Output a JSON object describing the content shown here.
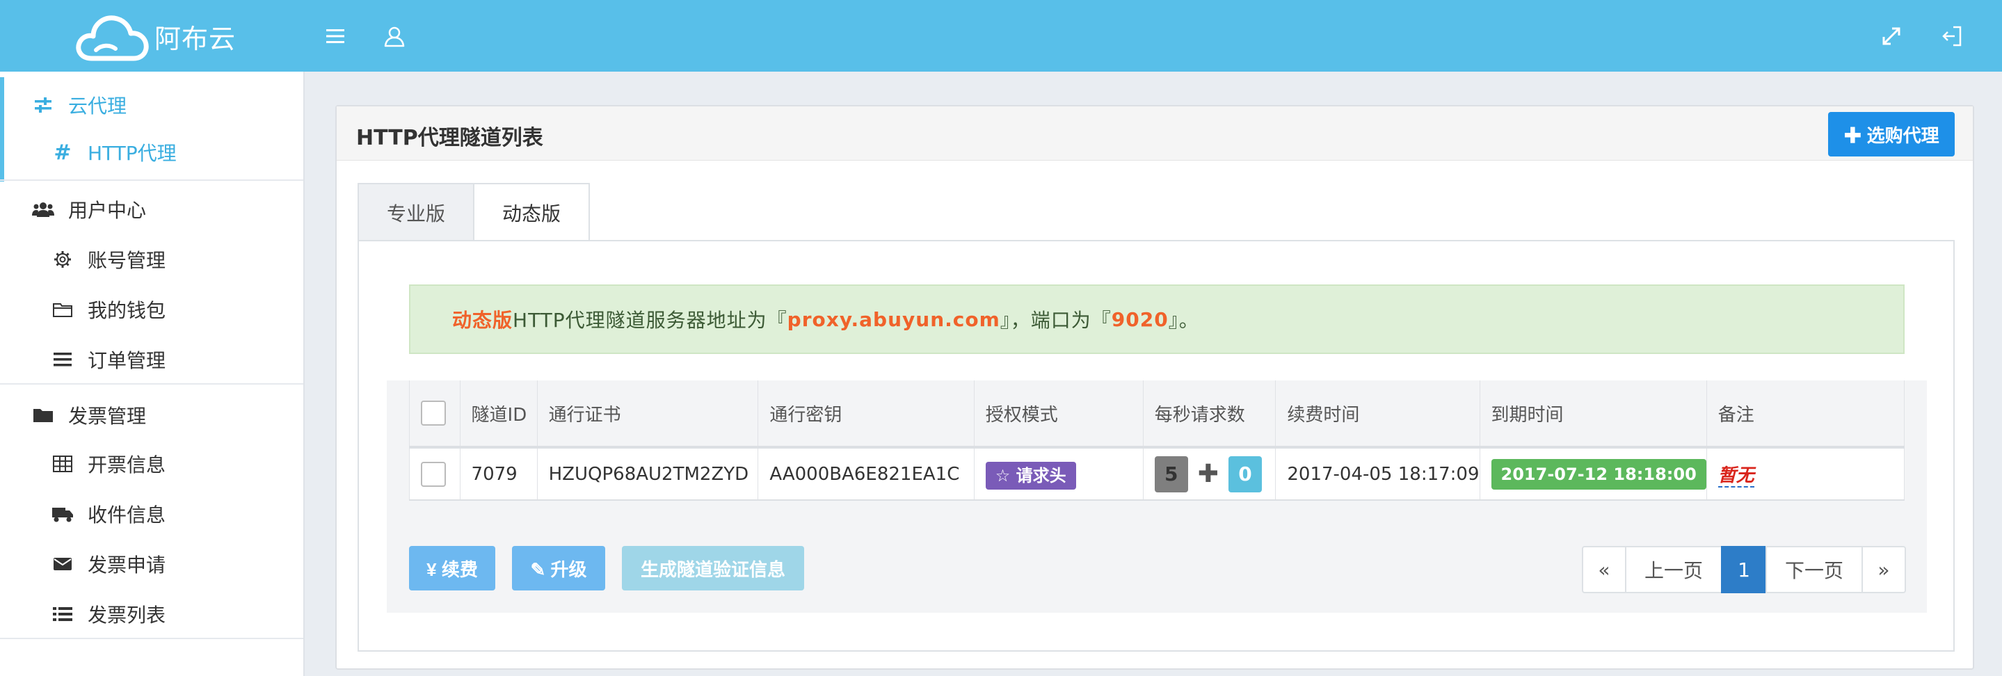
{
  "app": {
    "brand": "阿布云"
  },
  "icons": {
    "menu": "menu-icon",
    "user": "user-icon",
    "fullscreen": "fullscreen-icon",
    "logout": "logout-icon"
  },
  "colors": {
    "topbar": "#58bfe9",
    "accent": "#1e90e8",
    "orange": "#f0622a",
    "green": "#5cb85c",
    "purple": "#7a5bb8",
    "pager_active": "#2d7dc8"
  },
  "sidebar": {
    "sections": [
      {
        "label": "云代理",
        "icon": "sliders-icon",
        "items": [
          {
            "label": "HTTP代理",
            "icon": "hash-icon",
            "active": true
          }
        ]
      },
      {
        "label": "用户中心",
        "icon": "users-icon",
        "items": [
          {
            "label": "账号管理",
            "icon": "gear-icon"
          },
          {
            "label": "我的钱包",
            "icon": "wallet-icon"
          },
          {
            "label": "订单管理",
            "icon": "list-icon"
          }
        ]
      },
      {
        "label": "发票管理",
        "icon": "folder-icon",
        "items": [
          {
            "label": "开票信息",
            "icon": "table-icon"
          },
          {
            "label": "收件信息",
            "icon": "truck-icon"
          },
          {
            "label": "发票申请",
            "icon": "envelope-icon"
          },
          {
            "label": "发票列表",
            "icon": "list-ul-icon"
          }
        ]
      }
    ]
  },
  "panel": {
    "title": "HTTP代理隧道列表",
    "buy_button": "✚ 选购代理",
    "tabs": [
      "专业版",
      "动态版"
    ],
    "active_tab": "动态版",
    "notice": {
      "edition": "动态版",
      "text1": "HTTP代理隧道服务器地址为『",
      "host": "proxy.abuyun.com",
      "text2": "』，端口为『",
      "port": "9020",
      "text3": "』。"
    },
    "table": {
      "headers": [
        "隧道ID",
        "通行证书",
        "通行密钥",
        "授权模式",
        "每秒请求数",
        "续费时间",
        "到期时间",
        "备注"
      ],
      "rows": [
        {
          "id": "7079",
          "license": "HZUQP68AU2TM2ZYD",
          "secret": "AA000BA6E821EA1C",
          "auth_mode": "☆ 请求头",
          "rps_base": "5",
          "rps_extra": "0",
          "renew_time": "2017-04-05 18:17:09",
          "expire_time": "2017-07-12 18:18:00",
          "remark": "暂无"
        }
      ]
    },
    "actions": {
      "renew": "¥ 续费",
      "upgrade": "✎ 升级",
      "generate": "生成隧道验证信息"
    },
    "pager": {
      "first": "«",
      "prev": "上一页",
      "current": "1",
      "next": "下一页",
      "last": "»"
    }
  }
}
